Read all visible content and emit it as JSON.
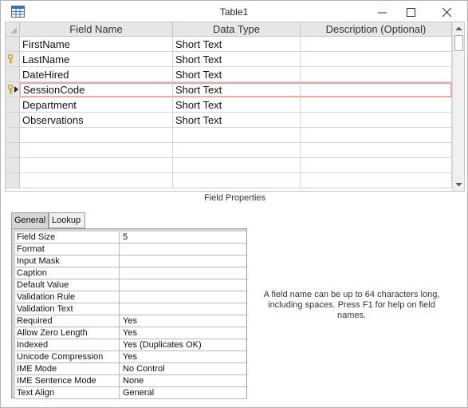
{
  "window": {
    "title": "Table1"
  },
  "grid": {
    "columns": [
      "Field Name",
      "Data Type",
      "Description (Optional)"
    ],
    "rows": [
      {
        "field": "FirstName",
        "type": "Short Text",
        "description": "",
        "key": false,
        "current": false
      },
      {
        "field": "LastName",
        "type": "Short Text",
        "description": "",
        "key": true,
        "current": false
      },
      {
        "field": "DateHired",
        "type": "Short Text",
        "description": "",
        "key": false,
        "current": false
      },
      {
        "field": "SessionCode",
        "type": "Short Text",
        "description": "",
        "key": true,
        "current": true
      },
      {
        "field": "Department",
        "type": "Short Text",
        "description": "",
        "key": false,
        "current": false
      },
      {
        "field": "Observations",
        "type": "Short Text",
        "description": "",
        "key": false,
        "current": false
      },
      {
        "field": "",
        "type": "",
        "description": "",
        "key": false,
        "current": false
      },
      {
        "field": "",
        "type": "",
        "description": "",
        "key": false,
        "current": false
      },
      {
        "field": "",
        "type": "",
        "description": "",
        "key": false,
        "current": false
      },
      {
        "field": "",
        "type": "",
        "description": "",
        "key": false,
        "current": false
      }
    ]
  },
  "field_properties": {
    "label": "Field Properties",
    "tabs": [
      "General",
      "Lookup"
    ],
    "active_tab": "General",
    "properties": [
      {
        "name": "Field Size",
        "value": "5"
      },
      {
        "name": "Format",
        "value": ""
      },
      {
        "name": "Input Mask",
        "value": ""
      },
      {
        "name": "Caption",
        "value": ""
      },
      {
        "name": "Default Value",
        "value": ""
      },
      {
        "name": "Validation Rule",
        "value": ""
      },
      {
        "name": "Validation Text",
        "value": ""
      },
      {
        "name": "Required",
        "value": "Yes"
      },
      {
        "name": "Allow Zero Length",
        "value": "Yes"
      },
      {
        "name": "Indexed",
        "value": "Yes (Duplicates OK)"
      },
      {
        "name": "Unicode Compression",
        "value": "Yes"
      },
      {
        "name": "IME Mode",
        "value": "No Control"
      },
      {
        "name": "IME Sentence Mode",
        "value": "None"
      },
      {
        "name": "Text Align",
        "value": "General"
      }
    ],
    "help_text": "A field name can be up to 64 characters long, including spaces. Press F1 for help on field names."
  },
  "colors": {
    "active_row_border": "#f3a6a6",
    "key_icon": "#c89a1a"
  }
}
